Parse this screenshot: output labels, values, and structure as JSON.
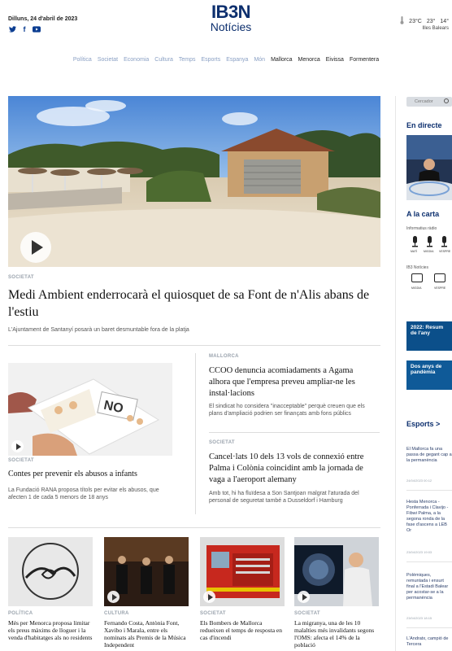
{
  "header": {
    "date": "Dilluns, 24 d'abril de 2023",
    "social": [
      {
        "name": "twitter-icon",
        "glyph": "🐦"
      },
      {
        "name": "facebook-icon",
        "glyph": "f"
      },
      {
        "name": "youtube-icon",
        "glyph": "▶"
      }
    ],
    "logo_line1": "IB3N",
    "logo_line2": "Notícies",
    "weather_temp": "23°C",
    "weather_min": "23°",
    "weather_max": "14°",
    "region": "Illes Balears"
  },
  "nav": {
    "items_faded": [
      "Política",
      "Societat",
      "Economia",
      "Cultura",
      "Temps",
      "Esports",
      "Espanya",
      "Món"
    ],
    "items_dark": [
      "Mallorca",
      "Menorca",
      "Eivissa",
      "Formentera"
    ]
  },
  "main": {
    "category": "SOCIETAT",
    "title": "Medi Ambient enderrocarà el quiosquet de sa Font de n'Alis abans de l'estiu",
    "subtitle": "L'Ajuntament de Santanyí posarà un baret desmuntable fora de la platja"
  },
  "secondary": {
    "left": {
      "category": "SOCIETAT",
      "title": "Contes per prevenir els abusos a infants",
      "subtitle": "La Fundació RANA proposa títols per evitar els abusos, que afecten 1 de cada 5 menors de 18 anys",
      "image_text": "NO"
    },
    "right": [
      {
        "category": "MALLORCA",
        "title": "CCOO denuncia acomiadaments a Agama alhora que l'empresa preveu ampliar-ne les instal·lacions",
        "subtitle": "El sindicat ho considera \"inacceptable\" perquè creuen que els plans d'ampliació podrien ser finançats amb fons públics"
      },
      {
        "category": "SOCIETAT",
        "title": "Cancel·lats 10 dels 13 vols de connexió entre Palma i Colònia coincidint amb la jornada de vaga a l'aeroport alemany",
        "subtitle": "Amb tot, hi ha fluïdesa a Son Santjoan malgrat l'aturada del personal de seguretat també a Dusseldorf i Hamburg"
      }
    ]
  },
  "bottom": [
    {
      "category": "POLÍTICA",
      "title": "Més per Menorca proposa limitar els preus màxims de lloguer i la venda d'habitatges als no residents"
    },
    {
      "category": "CULTURA",
      "title": "Fernando Costa, Antònia Font, Xavibo i Marala, entre els nominats als Premis de la Música Independent"
    },
    {
      "category": "SOCIETAT",
      "title": "Els Bombers de Mallorca redueixen el temps de resposta en cas d'incendi"
    },
    {
      "category": "SOCIETAT",
      "title": "La migranya, una de les 10 malalties més invalidants segons l'OMS: afecta el 14% de la població"
    }
  ],
  "sidebar": {
    "search_placeholder": "Cercador",
    "live_heading": "En directe",
    "carta_heading": "A la carta",
    "radio_label": "Informatius ràdio",
    "radio_items": [
      "MATÍ",
      "MIGDIA",
      "VESPRE"
    ],
    "tv_label": "IB3 Notícies",
    "tv_items": [
      "MIGDIA",
      "VESPRE"
    ],
    "banner1": "2022: Resum de l'any",
    "banner2": "Dos anys de pandèmia",
    "sports_heading": "Esports >",
    "news": [
      {
        "title": "El Mallorca fa una passa de gegant cap a la permanència",
        "time": "24/04/2023 00:12"
      },
      {
        "title": "Hesta Menorca - Ponferrada i Clavijo - Fibwi Palma, a la segona ronda de la fase d'ascens a LEB Or",
        "time": "23/04/2023 19:03"
      },
      {
        "title": "Polèmiques, remuntada i ensurt final a l'Estadi Balear per acostar-se a la permanència",
        "time": "23/04/2023 18:15"
      },
      {
        "title": "L'Andratx, campió de Tercera",
        "time": ""
      }
    ]
  }
}
